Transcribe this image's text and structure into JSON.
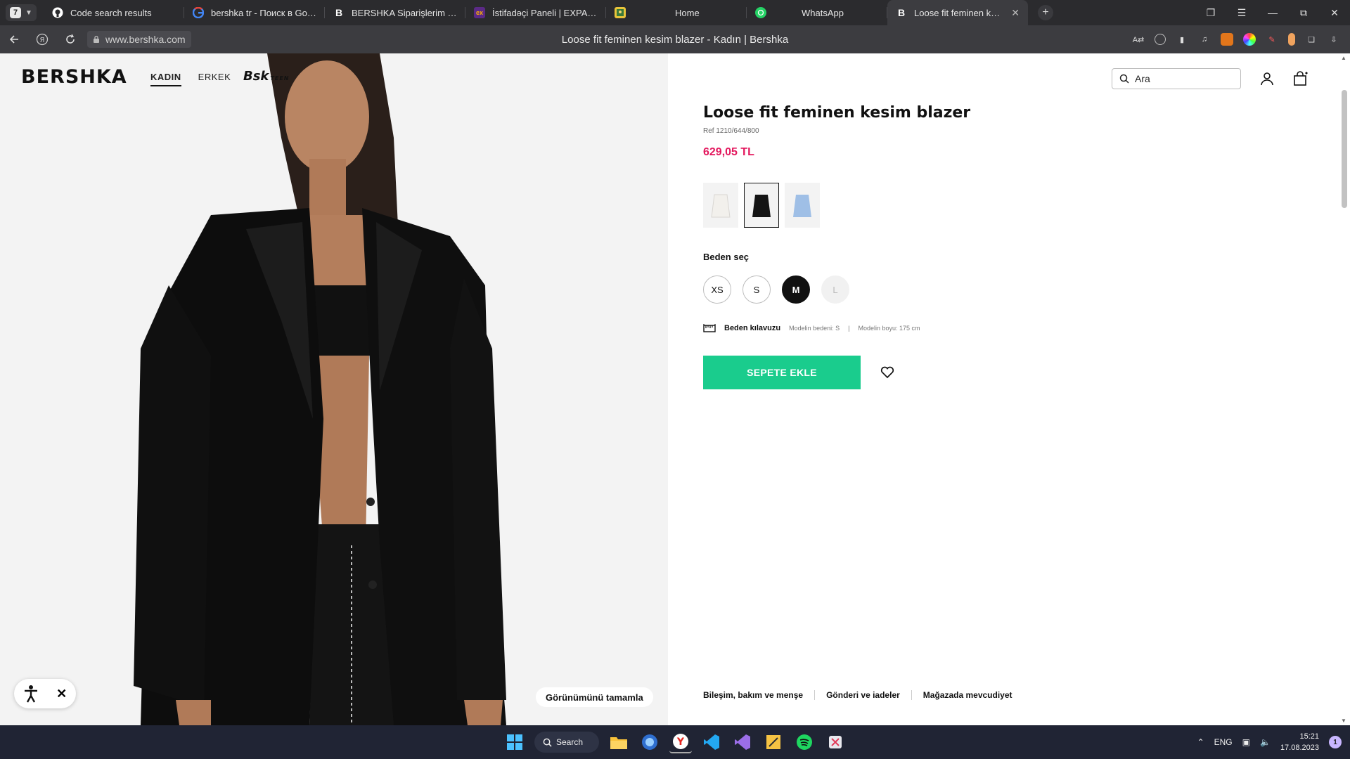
{
  "browser": {
    "tab_count": "7",
    "tabs": [
      {
        "title": "Code search results",
        "icon": "github-icon"
      },
      {
        "title": "bershka tr - Поиск в Google",
        "icon": "google-icon"
      },
      {
        "title": "BERSHKA Siparişlerim | Bershka",
        "icon": "bershka-b-icon"
      },
      {
        "title": "İstifadəçi Paneli | EXPARGO",
        "icon": "expargo-icon"
      },
      {
        "title": "Home",
        "icon": "home-image-icon"
      },
      {
        "title": "WhatsApp",
        "icon": "whatsapp-icon"
      },
      {
        "title": "Loose fit feminen kesim blazer",
        "icon": "bershka-b-icon",
        "active": true
      }
    ],
    "url": "www.bershka.com",
    "page_title": "Loose fit feminen kesim blazer - Kadın | Bershka"
  },
  "site": {
    "logo": "BERSHKA",
    "nav": [
      "KADIN",
      "ERKEK"
    ],
    "teen_logo": "Bsk",
    "teen_logo_sub": "TEEN",
    "search_placeholder": "Ara"
  },
  "product": {
    "title": "Loose fit feminen kesim blazer",
    "ref": "Ref 1210/644/800",
    "price": "629,05 TL",
    "price_color": "#e3175d",
    "colors": [
      {
        "name": "white",
        "hex": "#f2f0ec"
      },
      {
        "name": "black",
        "hex": "#141414",
        "selected": true
      },
      {
        "name": "light-blue",
        "hex": "#9fbfe6"
      }
    ],
    "size_label": "Beden seç",
    "sizes": [
      {
        "label": "XS",
        "state": "available"
      },
      {
        "label": "S",
        "state": "available"
      },
      {
        "label": "M",
        "state": "selected"
      },
      {
        "label": "L",
        "state": "disabled"
      }
    ],
    "size_guide": "Beden kılavuzu",
    "model_size": "Modelin bedeni: S",
    "model_height": "Modelin boyu: 175 cm",
    "add_to_cart": "SEPETE EKLE",
    "add_to_cart_color": "#1acc8d",
    "info_links": [
      "Bileşim, bakım ve menşe",
      "Gönderi ve iadeler",
      "Mağazada mevcudiyet"
    ]
  },
  "image_overlay": {
    "complete_look": "Görünümünü tamamla"
  },
  "taskbar": {
    "search_label": "Search",
    "lang": "ENG",
    "time": "15:21",
    "date": "17.08.2023",
    "notifications": "1"
  }
}
